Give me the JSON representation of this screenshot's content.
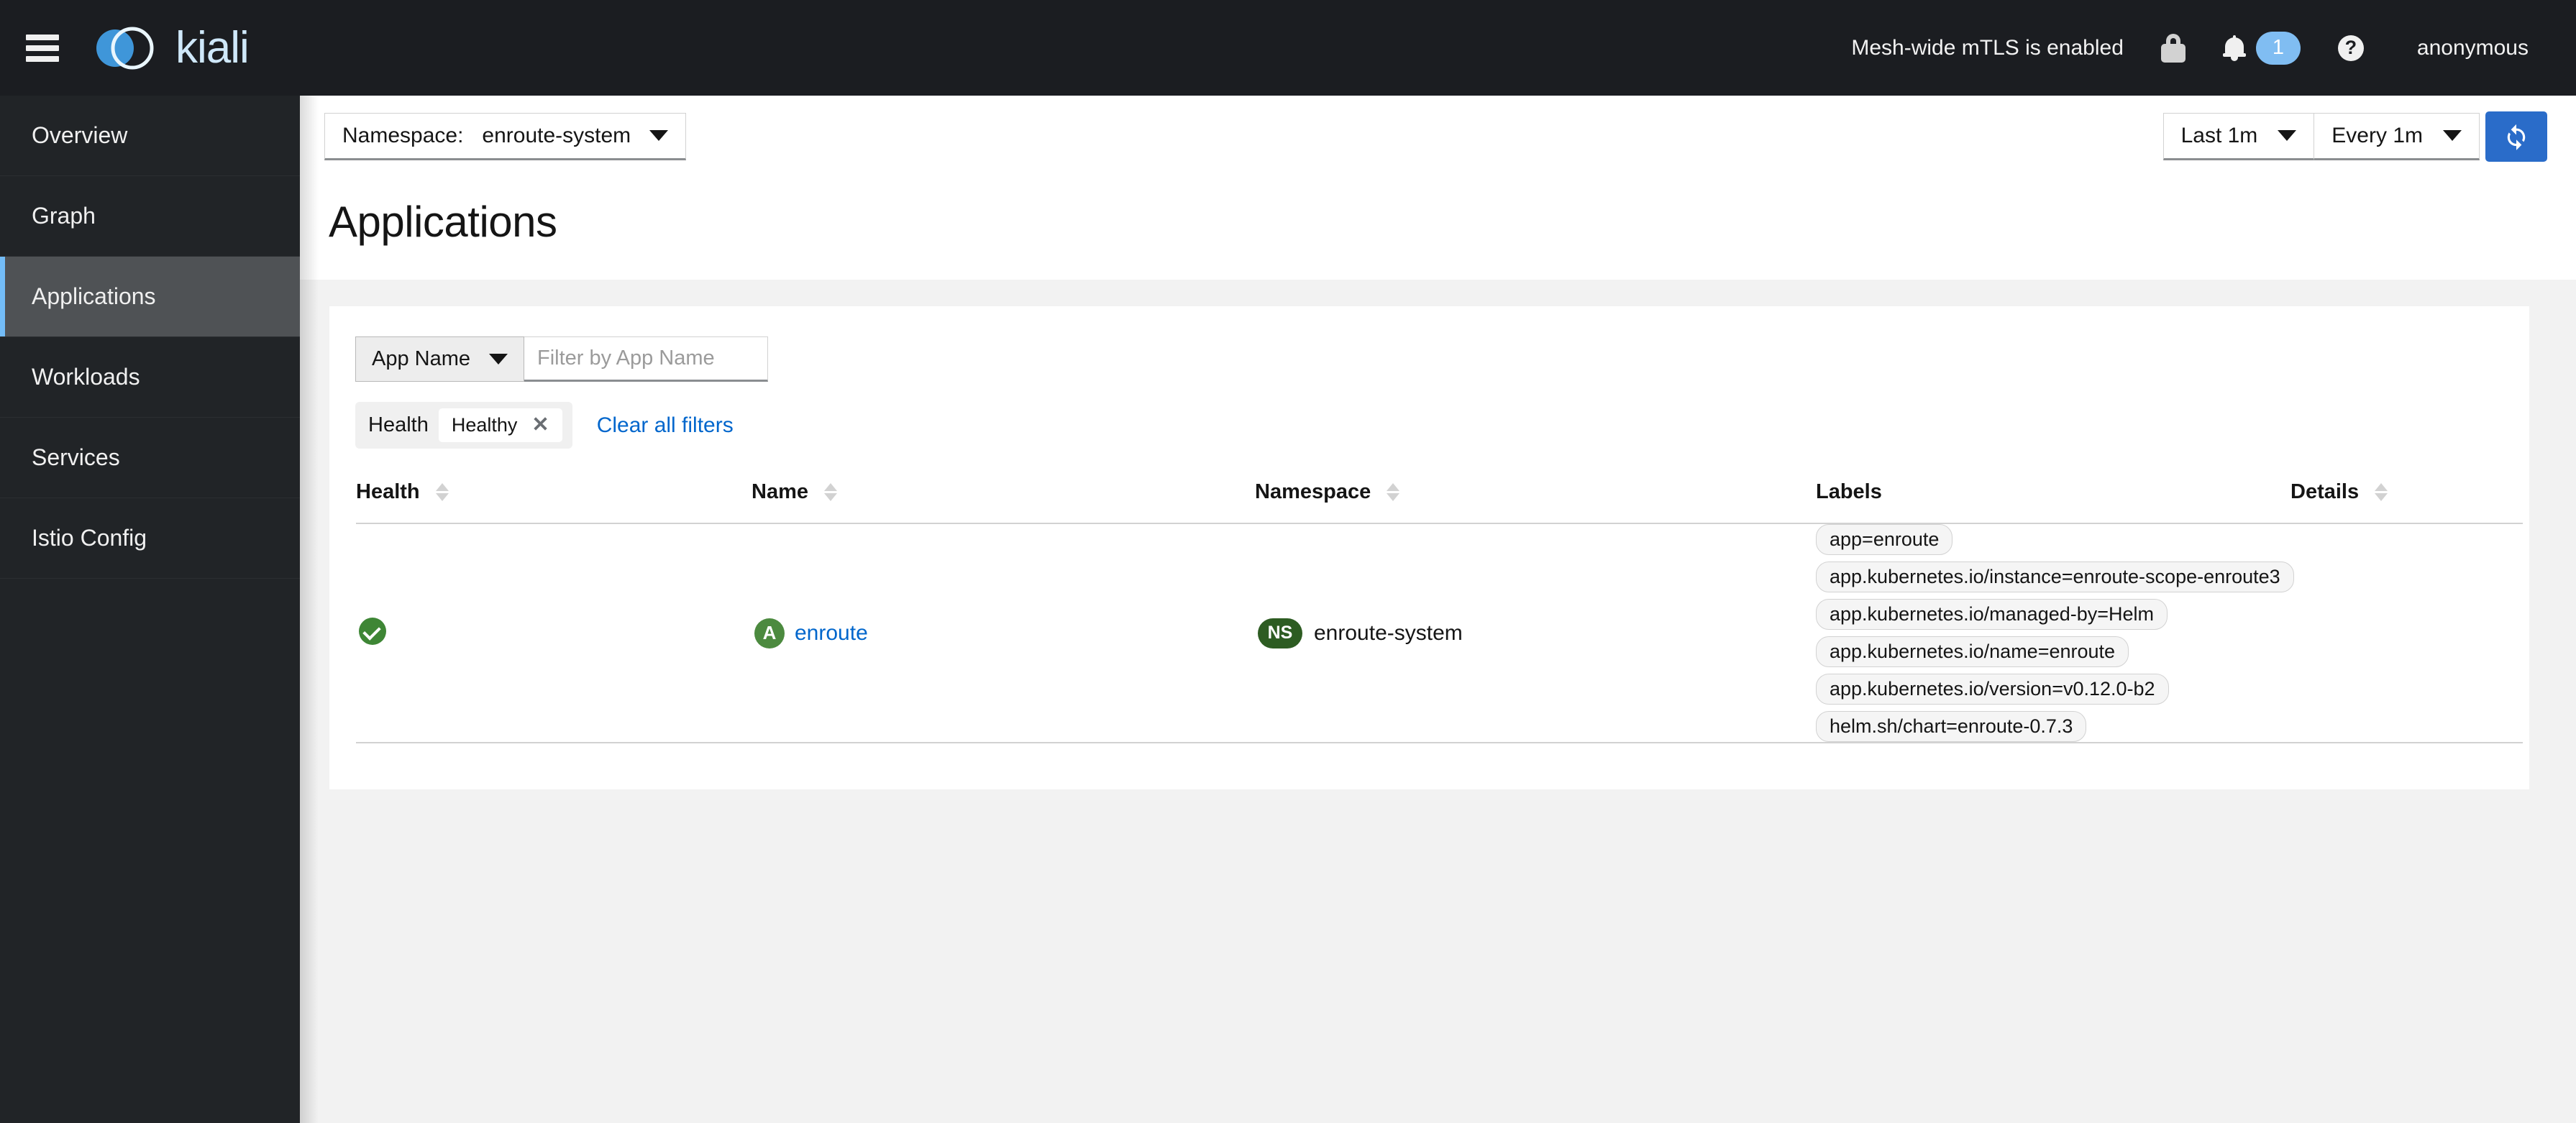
{
  "masthead": {
    "menu_toggle": "menu",
    "brand_text": "kiali",
    "mtls_status": "Mesh-wide mTLS is enabled",
    "lock_icon": "lock-icon",
    "bell_icon": "bell-icon",
    "notification_count": "1",
    "help_icon": "?",
    "username": "anonymous"
  },
  "sidebar": {
    "items": [
      {
        "label": "Overview",
        "active": false
      },
      {
        "label": "Graph",
        "active": false
      },
      {
        "label": "Applications",
        "active": true
      },
      {
        "label": "Workloads",
        "active": false
      },
      {
        "label": "Services",
        "active": false
      },
      {
        "label": "Istio Config",
        "active": false
      }
    ]
  },
  "toolbar": {
    "namespace_label": "Namespace:",
    "namespace_value": "enroute-system",
    "time_range": "Last 1m",
    "refresh_interval": "Every 1m",
    "refresh_icon": "refresh-icon"
  },
  "page": {
    "title": "Applications"
  },
  "filters": {
    "category_select": "App Name",
    "input_value": "",
    "input_placeholder": "Filter by App Name",
    "chip_group_label": "Health",
    "chip_value": "Healthy",
    "chip_remove": "✕",
    "clear_all": "Clear all filters"
  },
  "table": {
    "columns": [
      {
        "label": "Health",
        "sortable": true
      },
      {
        "label": "Name",
        "sortable": true
      },
      {
        "label": "Namespace",
        "sortable": true
      },
      {
        "label": "Labels",
        "sortable": false
      },
      {
        "label": "Details",
        "sortable": true
      }
    ],
    "rows": [
      {
        "health": "healthy",
        "name_badge": "A",
        "name": "enroute",
        "namespace_badge": "NS",
        "namespace": "enroute-system",
        "labels": [
          "app=enroute",
          "app.kubernetes.io/instance=enroute-scope-enroute3",
          "app.kubernetes.io/managed-by=Helm",
          "app.kubernetes.io/name=enroute",
          "app.kubernetes.io/version=v0.12.0-b2",
          "helm.sh/chart=enroute-0.7.3"
        ],
        "details": ""
      }
    ]
  },
  "colors": {
    "masthead_bg": "#1b1d21",
    "sidebar_bg": "#212427",
    "sidebar_active_bg": "#4f5255",
    "accent_blue": "#73bcf7",
    "link_blue": "#0066cc",
    "primary_blue": "#2a6cc9",
    "health_green": "#3e8635",
    "app_badge_green": "#4c8a3f",
    "ns_badge_green": "#2d5c22",
    "page_bg": "#f2f2f2"
  }
}
